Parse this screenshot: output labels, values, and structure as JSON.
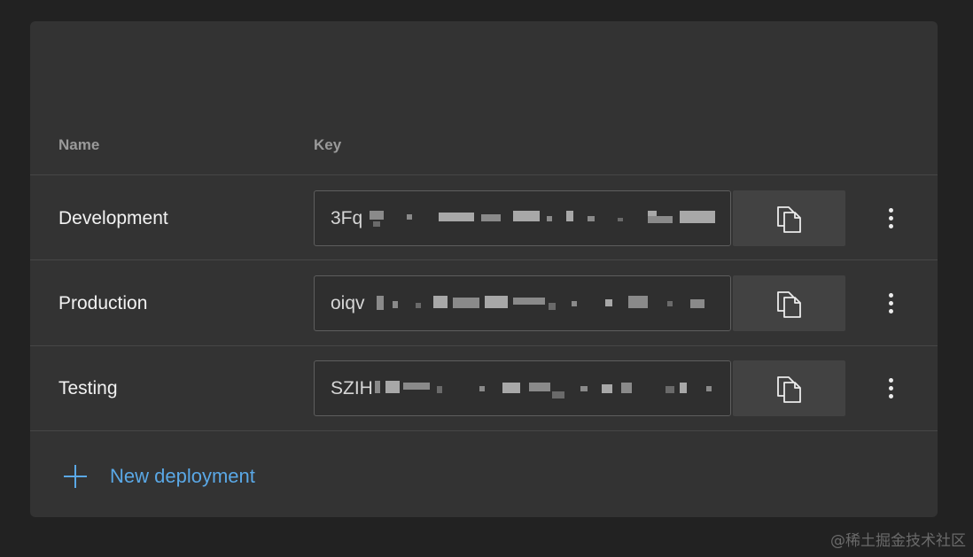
{
  "columns": {
    "name": "Name",
    "key": "Key"
  },
  "deployments": [
    {
      "name": "Development",
      "key_prefix": "3Fq"
    },
    {
      "name": "Production",
      "key_prefix": "oiqv"
    },
    {
      "name": "Testing",
      "key_prefix": "SZIH"
    }
  ],
  "actions": {
    "new_deployment_label": "New deployment"
  },
  "icons": {
    "copy": "copy-icon",
    "more": "more-vertical-icon",
    "add": "plus-icon"
  },
  "colors": {
    "background": "#222222",
    "panel": "#333333",
    "accent": "#5aa8e6"
  },
  "watermark": "@稀土掘金技术社区"
}
